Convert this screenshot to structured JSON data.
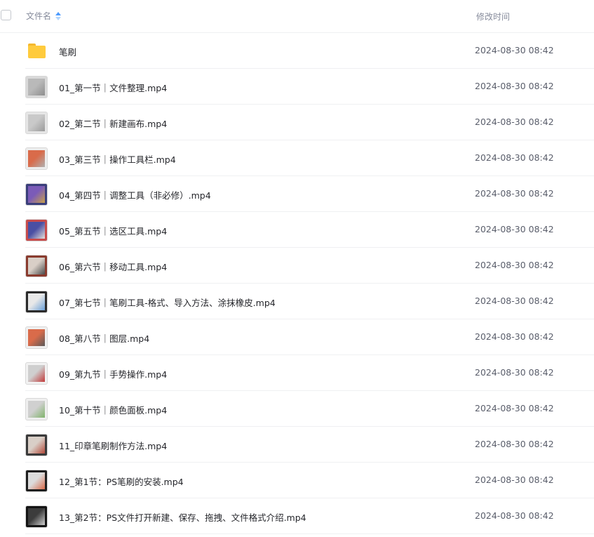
{
  "header": {
    "name_label": "文件名",
    "time_label": "修改时间"
  },
  "colors": {
    "accent": "#4d9bfe",
    "folder": "#ffcb3d",
    "divider": "#eff0f2"
  },
  "rows": [
    {
      "name": "笔刷",
      "time": "2024-08-30 08:42",
      "type": "folder",
      "thumb_colors": []
    },
    {
      "name": "01_第一节｜文件整理.mp4",
      "time": "2024-08-30 08:42",
      "type": "video",
      "thumb_colors": [
        "#d9d9d9",
        "#b9b9b9",
        "#8e8e8e"
      ]
    },
    {
      "name": "02_第二节｜新建画布.mp4",
      "time": "2024-08-30 08:42",
      "type": "video",
      "thumb_colors": [
        "#e6e6e6",
        "#c9c9c9",
        "#9a9a9a"
      ]
    },
    {
      "name": "03_第三节｜操作工具栏.mp4",
      "time": "2024-08-30 08:42",
      "type": "video",
      "thumb_colors": [
        "#ededed",
        "#d96b4a",
        "#b0b0b0"
      ]
    },
    {
      "name": "04_第四节｜调整工具（非必修）.mp4",
      "time": "2024-08-30 08:42",
      "type": "video",
      "thumb_colors": [
        "#3a3f7a",
        "#7b5bb8",
        "#c9a14a"
      ]
    },
    {
      "name": "05_第五节｜选区工具.mp4",
      "time": "2024-08-30 08:42",
      "type": "video",
      "thumb_colors": [
        "#c84b4b",
        "#4a4fa3",
        "#e8e0d8"
      ]
    },
    {
      "name": "06_第六节｜移动工具.mp4",
      "time": "2024-08-30 08:42",
      "type": "video",
      "thumb_colors": [
        "#8a3b2e",
        "#d9cfc7",
        "#4a4a4a"
      ]
    },
    {
      "name": "07_第七节｜笔刷工具-格式、导入方法、涂抹橡皮.mp4",
      "time": "2024-08-30 08:42",
      "type": "video",
      "thumb_colors": [
        "#2b2b2b",
        "#e8e8e8",
        "#6aa0d8"
      ]
    },
    {
      "name": "08_第八节｜图层.mp4",
      "time": "2024-08-30 08:42",
      "type": "video",
      "thumb_colors": [
        "#f0f0f0",
        "#d96b4a",
        "#5a5a5a"
      ]
    },
    {
      "name": "09_第九节｜手势操作.mp4",
      "time": "2024-08-30 08:42",
      "type": "video",
      "thumb_colors": [
        "#f2f2f2",
        "#cfcfcf",
        "#c23a3a"
      ]
    },
    {
      "name": "10_第十节｜颜色面板.mp4",
      "time": "2024-08-30 08:42",
      "type": "video",
      "thumb_colors": [
        "#efefef",
        "#d0d0d0",
        "#7fb36a"
      ]
    },
    {
      "name": "11_印章笔刷制作方法.mp4",
      "time": "2024-08-30 08:42",
      "type": "video",
      "thumb_colors": [
        "#3a3a3a",
        "#d9cfc7",
        "#b34a3a"
      ]
    },
    {
      "name": "12_第1节：PS笔刷的安装.mp4",
      "time": "2024-08-30 08:42",
      "type": "video",
      "thumb_colors": [
        "#1e1e1e",
        "#dcdcdc",
        "#d96b4a"
      ]
    },
    {
      "name": "13_第2节：PS文件打开新建、保存、拖拽、文件格式介绍.mp4",
      "time": "2024-08-30 08:42",
      "type": "video",
      "thumb_colors": [
        "#141414",
        "#3c3c3c",
        "#cfcfcf"
      ]
    }
  ]
}
